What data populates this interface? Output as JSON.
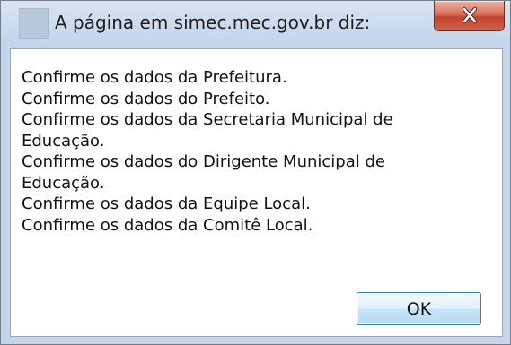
{
  "window": {
    "title": "A página em simec.mec.gov.br diz:"
  },
  "message": {
    "lines": [
      "Confirme os dados da Prefeitura.",
      "Confirme os dados do Prefeito.",
      "Confirme os dados da Secretaria Municipal de",
      "Educação.",
      "Confirme os dados do Dirigente Municipal de",
      "Educação.",
      "Confirme os dados da Equipe Local.",
      "Confirme os dados da Comitê Local."
    ]
  },
  "buttons": {
    "ok_label": "OK"
  },
  "icons": {
    "title": "page-icon",
    "close": "close-icon"
  },
  "colors": {
    "frame": "#c6d6ea",
    "close_button": "#c14530",
    "ok_button_border": "#3c7fb1"
  }
}
